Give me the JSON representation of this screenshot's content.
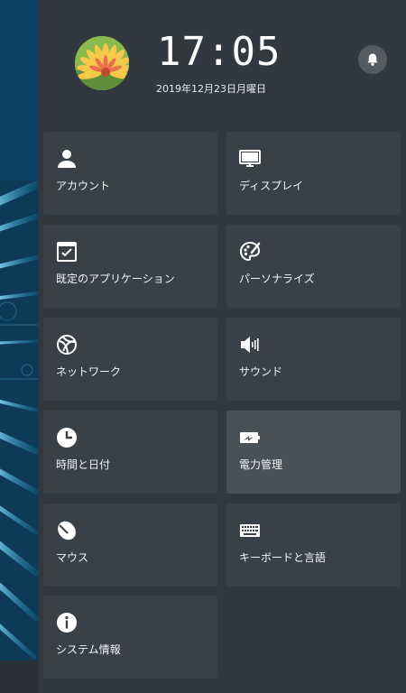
{
  "header": {
    "time": "17:05",
    "date": "2019年12月23日月曜日"
  },
  "tiles": [
    {
      "label": "アカウント",
      "icon": "user-icon"
    },
    {
      "label": "ディスプレイ",
      "icon": "monitor-icon"
    },
    {
      "label": "既定のアプリケーション",
      "icon": "default-apps-icon"
    },
    {
      "label": "パーソナライズ",
      "icon": "palette-icon"
    },
    {
      "label": "ネットワーク",
      "icon": "network-globe-icon"
    },
    {
      "label": "サウンド",
      "icon": "speaker-icon"
    },
    {
      "label": "時間と日付",
      "icon": "clock-icon"
    },
    {
      "label": "電力管理",
      "icon": "battery-charging-icon"
    },
    {
      "label": "マウス",
      "icon": "mouse-icon"
    },
    {
      "label": "キーボードと言語",
      "icon": "keyboard-icon"
    },
    {
      "label": "システム情報",
      "icon": "info-icon"
    }
  ],
  "colors": {
    "panel_bg": "#323840",
    "tile_bg": "#3a4048",
    "tile_active_bg": "#4a5058",
    "text": "#ffffff"
  }
}
